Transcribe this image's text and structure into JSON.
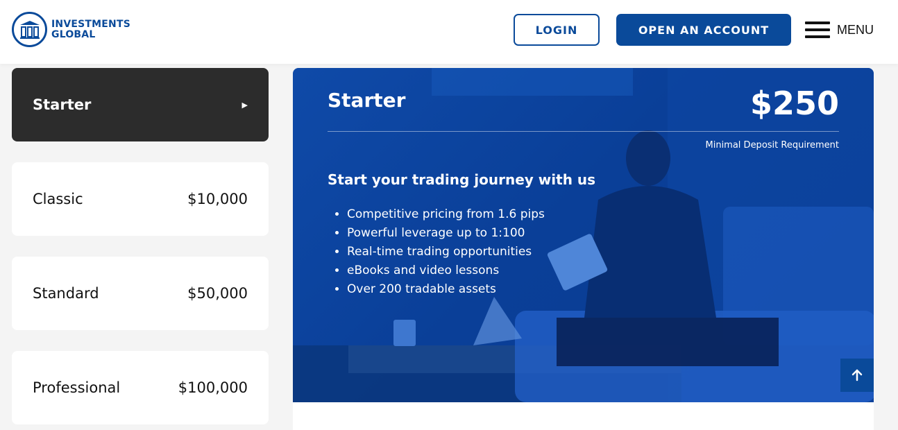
{
  "header": {
    "logo_line1": "INVESTMENTS",
    "logo_line2": "GLOBAL",
    "login_label": "LOGIN",
    "open_account_label": "OPEN AN ACCOUNT",
    "menu_label": "MENU"
  },
  "plans": [
    {
      "name": "Starter",
      "amount": "",
      "active": true
    },
    {
      "name": "Classic",
      "amount": "$10,000",
      "active": false
    },
    {
      "name": "Standard",
      "amount": "$50,000",
      "active": false
    },
    {
      "name": "Professional",
      "amount": "$100,000",
      "active": false
    }
  ],
  "hero": {
    "title": "Starter",
    "price": "$250",
    "caption": "Minimal Deposit Requirement",
    "subtitle": "Start your trading journey with us",
    "features": [
      "Competitive pricing from 1.6 pips",
      "Powerful leverage up to 1:100",
      "Real-time trading opportunities",
      "eBooks and video lessons",
      "Over 200 tradable assets"
    ]
  },
  "colors": {
    "brand_blue": "#0a4a9a",
    "active_card": "#2c2c2c",
    "hero_blue": "#0a3f98"
  },
  "icons": {
    "logo": "pillars-logo-icon",
    "menu": "hamburger-icon",
    "active_arrow": "caret-right-icon",
    "scroll_top": "arrow-up-icon"
  }
}
